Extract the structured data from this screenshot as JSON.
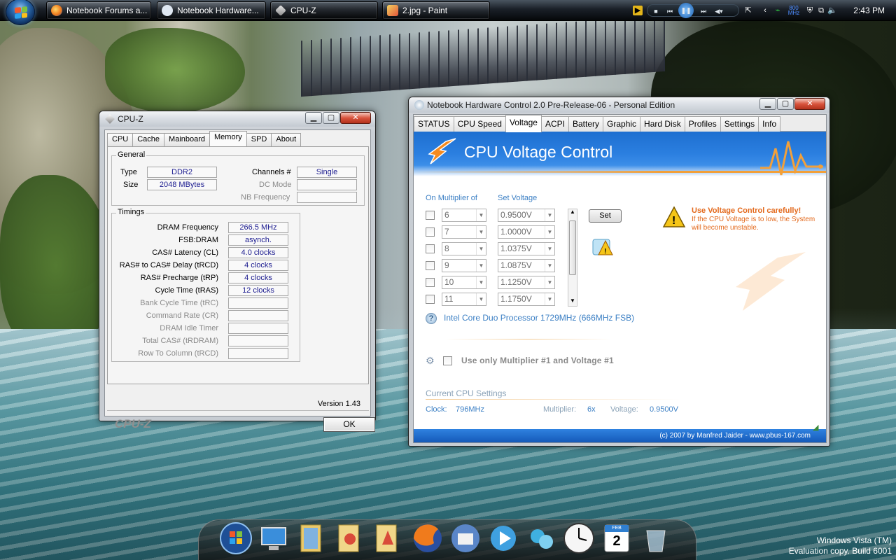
{
  "taskbar": {
    "buttons": [
      {
        "label": "Notebook Forums a..."
      },
      {
        "label": "Notebook Hardware..."
      },
      {
        "label": "CPU-Z"
      },
      {
        "label": "2.jpg - Paint"
      }
    ],
    "clock": "2:43 PM",
    "tray_freq": "800 MHz"
  },
  "cpuz": {
    "title": "CPU-Z",
    "tabs": [
      "CPU",
      "Cache",
      "Mainboard",
      "Memory",
      "SPD",
      "About"
    ],
    "active_tab": "Memory",
    "general": {
      "label": "General",
      "type_label": "Type",
      "type_value": "DDR2",
      "size_label": "Size",
      "size_value": "2048 MBytes",
      "channels_label": "Channels #",
      "channels_value": "Single",
      "dcmode_label": "DC Mode",
      "nbfreq_label": "NB Frequency"
    },
    "timings": {
      "label": "Timings",
      "rows": [
        {
          "label": "DRAM Frequency",
          "value": "266.5 MHz",
          "enabled": true
        },
        {
          "label": "FSB:DRAM",
          "value": "asynch.",
          "enabled": true
        },
        {
          "label": "CAS# Latency (CL)",
          "value": "4.0 clocks",
          "enabled": true
        },
        {
          "label": "RAS# to CAS# Delay (tRCD)",
          "value": "4 clocks",
          "enabled": true
        },
        {
          "label": "RAS# Precharge (tRP)",
          "value": "4 clocks",
          "enabled": true
        },
        {
          "label": "Cycle Time (tRAS)",
          "value": "12 clocks",
          "enabled": true
        },
        {
          "label": "Bank Cycle Time (tRC)",
          "value": "",
          "enabled": false
        },
        {
          "label": "Command Rate (CR)",
          "value": "",
          "enabled": false
        },
        {
          "label": "DRAM Idle Timer",
          "value": "",
          "enabled": false
        },
        {
          "label": "Total CAS# (tRDRAM)",
          "value": "",
          "enabled": false
        },
        {
          "label": "Row To Column (tRCD)",
          "value": "",
          "enabled": false
        }
      ]
    },
    "version": "Version 1.43",
    "brand": "CPU-Z",
    "ok_label": "OK"
  },
  "nhc": {
    "title": "Notebook Hardware Control 2.0 Pre-Release-06  -  Personal Edition",
    "tabs": [
      "STATUS",
      "CPU Speed",
      "Voltage",
      "ACPI",
      "Battery",
      "Graphic",
      "Hard Disk",
      "Profiles",
      "Settings",
      "Info"
    ],
    "active_tab": "Voltage",
    "banner_title": "CPU Voltage Control",
    "multiplier_header": "On Multiplier of",
    "voltage_header": "Set Voltage",
    "rows": [
      {
        "multiplier": "6",
        "voltage": "0.9500V"
      },
      {
        "multiplier": "7",
        "voltage": "1.0000V"
      },
      {
        "multiplier": "8",
        "voltage": "1.0375V"
      },
      {
        "multiplier": "9",
        "voltage": "1.0875V"
      },
      {
        "multiplier": "10",
        "voltage": "1.1250V"
      },
      {
        "multiplier": "11",
        "voltage": "1.1750V"
      }
    ],
    "set_label": "Set",
    "warning_title": "Use Voltage Control carefully!",
    "warning_text": "If the CPU Voltage is to low, the System will become unstable.",
    "processor": "Intel Core Duo Processor 1729MHz (666MHz FSB)",
    "use_only_label": "Use only Multiplier #1 and Voltage #1",
    "current_header": "Current CPU Settings",
    "clock_label": "Clock:",
    "clock_value": "796MHz",
    "multiplier_label": "Multiplier:",
    "multiplier_value": "6x",
    "voltage_label": "Voltage:",
    "voltage_value": "0.9500V",
    "footer": "(c) 2007 by Manfred Jaider - www.pbus-167.com"
  },
  "dock": {
    "calendar_month": "FEB",
    "calendar_day": "2"
  },
  "watermark": {
    "line1": "Windows Vista (TM)",
    "line2": "Evaluation copy. Build 6001"
  }
}
